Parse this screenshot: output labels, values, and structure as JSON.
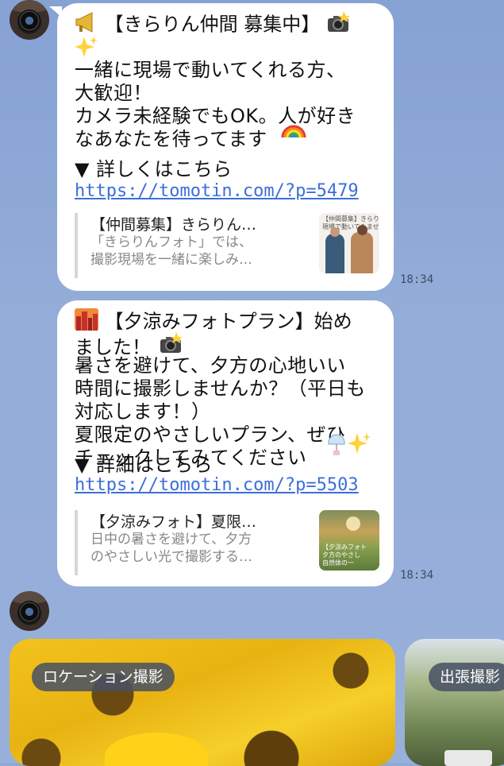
{
  "messages": [
    {
      "title": "【きらりん仲間 募集中】",
      "body": "一緒に現場で動いてくれる方、\n大歓迎！\nカメラ未経験でもOK。人が好き\nなあなたを待ってます",
      "detail_label": "▼ 詳しくはこちら",
      "link": "https://tomotin.com/?p=5479",
      "preview": {
        "title": "【仲間募集】きらりん…",
        "description": "「きらりんフォト」では、\n撮影現場を一緒に楽しみ…",
        "thumb_caption": "【仲間募集】きらりん\n現場で動いてみませ"
      },
      "time": "18:34"
    },
    {
      "title": "【夕涼みフォトプラン】始め\nました！",
      "body": "暑さを避けて、夕方の心地いい\n時間に撮影しませんか？（平日も\n対応します！）\n夏限定のやさしいプラン、ぜひ\nチェックしてみてください",
      "detail_label": "▼ 詳細はこちら",
      "link": "https://tomotin.com/?p=5503",
      "preview": {
        "title": "【夕涼みフォト】夏限…",
        "description": "日中の暑さを避けて、夕方\nのやさしい光で撮影する…",
        "thumb_caption": "【夕涼みフォト\n夕方のやさし\n自然体の一"
      },
      "time": "18:34"
    }
  ],
  "cards": [
    {
      "label": "ロケーション撮影"
    },
    {
      "label": "出張撮影"
    }
  ],
  "icons": {
    "megaphone": "megaphone-icon",
    "camera_flash": "camera-flash-icon",
    "sparkles": "sparkles-icon",
    "rainbow": "rainbow-icon",
    "cityscape": "sunset-city-icon",
    "wind_chime": "wind-chime-icon"
  },
  "colors": {
    "background": "#8fa9d6",
    "bubble": "#ffffff",
    "link": "#3b6fd9",
    "timestamp": "#3f4c63"
  }
}
